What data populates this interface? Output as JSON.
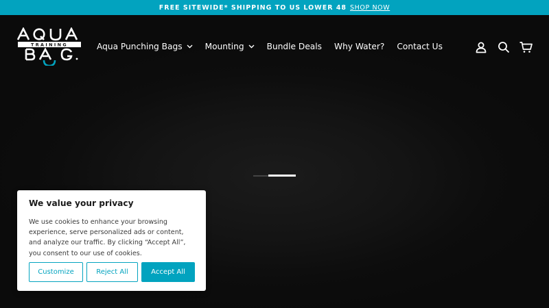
{
  "announcement": {
    "text": "FREE SITEWIDE* SHIPPING TO US LOWER 48",
    "link": "SHOP NOW"
  },
  "header": {
    "logo_text": "AQUA TRAINING BAG",
    "nav": [
      {
        "label": "Aqua Punching Bags",
        "has_dropdown": true
      },
      {
        "label": "Mounting",
        "has_dropdown": true
      },
      {
        "label": "Bundle Deals",
        "has_dropdown": false
      },
      {
        "label": "Why Water?",
        "has_dropdown": false
      },
      {
        "label": "Contact Us",
        "has_dropdown": false
      }
    ],
    "icons": [
      "account-icon",
      "search-icon",
      "cart-icon"
    ]
  },
  "hero": {
    "slides_total": 2,
    "active_slide": 2
  },
  "cookie": {
    "title": "We value your privacy",
    "text": "We use cookies to enhance your browsing experience, serve personalized ads or content, and analyze our traffic. By clicking “Accept All”, you consent to our use of cookies.",
    "customize": "Customize",
    "reject": "Reject All",
    "accept": "Accept All"
  },
  "colors": {
    "accent": "#02a3bf",
    "background": "#0c0c0c"
  }
}
